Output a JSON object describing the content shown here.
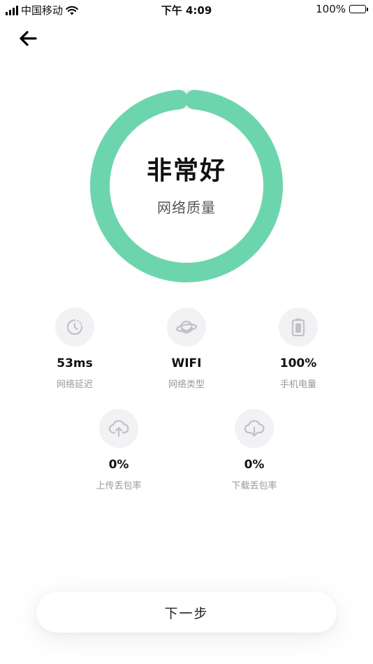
{
  "status_bar": {
    "carrier": "中国移动",
    "time": "下午 4:09",
    "battery_text": "100%"
  },
  "ring": {
    "title": "非常好",
    "subtitle": "网络质量",
    "progress_percent": 97,
    "color": "#6dd5ae",
    "track_color": "#f0f0f3"
  },
  "stats": [
    {
      "icon": "clock-icon",
      "value": "53ms",
      "label": "网络延迟"
    },
    {
      "icon": "planet-icon",
      "value": "WIFI",
      "label": "网络类型"
    },
    {
      "icon": "battery-icon",
      "value": "100%",
      "label": "手机电量"
    },
    {
      "icon": "cloud-upload-icon",
      "value": "0%",
      "label": "上传丢包率"
    },
    {
      "icon": "cloud-download-icon",
      "value": "0%",
      "label": "下载丢包率"
    }
  ],
  "next_button": {
    "label": "下一步"
  }
}
